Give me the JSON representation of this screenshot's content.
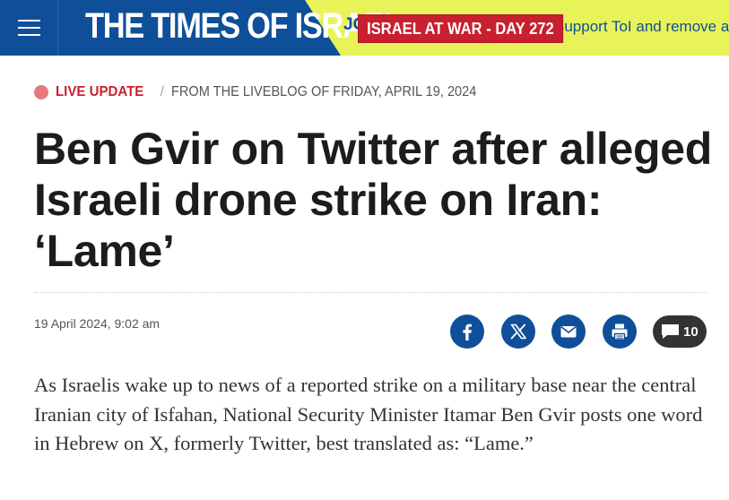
{
  "header": {
    "logo_text": "THE TIMES OF ISRAEL",
    "join_text": "JOIN",
    "support_text": "Support ToI and remove all ads",
    "war_badge": "ISRAEL AT WAR - DAY 272",
    "brand_color": "#0f4f99",
    "promo_color": "#e8f35a",
    "badge_color": "#c8202f",
    "menu_icon": "hamburger-icon"
  },
  "kicker": {
    "live_label": "LIVE UPDATE",
    "separator": "/",
    "from_text": "FROM THE LIVEBLOG OF FRIDAY, APRIL 19, 2024"
  },
  "article": {
    "headline": "Ben Gvir on Twitter after alleged Israeli drone strike on Iran: ‘Lame’",
    "dateline": "19 April 2024, 9:02 am",
    "lede": "As Israelis wake up to news of a reported strike on a military base near the central Iranian city of Isfahan, National Security Minister Itamar Ben Gvir posts one word in Hebrew on X, formerly Twitter, best translated as: “Lame.”"
  },
  "share": {
    "icons": [
      "facebook-icon",
      "x-icon",
      "email-icon",
      "print-icon",
      "comment-icon"
    ],
    "comment_count": "10"
  }
}
